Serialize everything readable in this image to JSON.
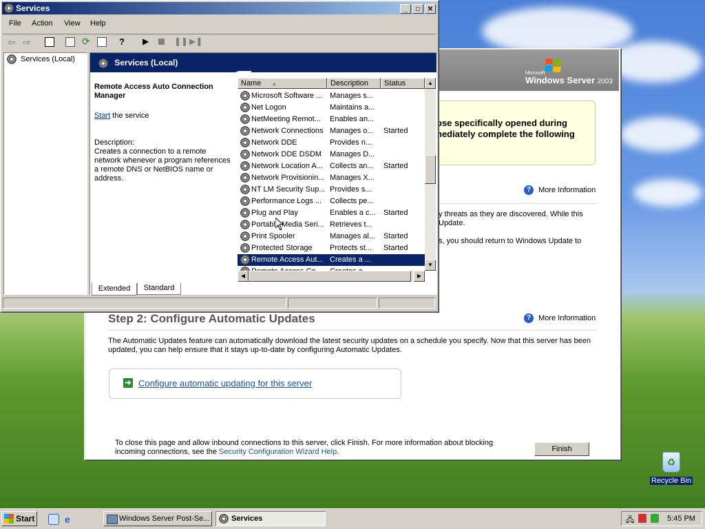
{
  "services_window": {
    "title": "Services",
    "menu": [
      "File",
      "Action",
      "View",
      "Help"
    ],
    "tree_root": "Services (Local)",
    "pane_header": "Services (Local)",
    "selected_service_name": "Remote Access Auto Connection Manager",
    "start_link": "Start",
    "start_suffix": " the service",
    "description_label": "Description:",
    "description_text": "Creates a connection to a remote network whenever a program references a remote DNS or NetBIOS name or address.",
    "columns": {
      "name": "Name",
      "description": "Description",
      "status": "Status"
    },
    "rows": [
      {
        "name": "Microsoft Software ...",
        "description": "Manages s...",
        "status": ""
      },
      {
        "name": "Net Logon",
        "description": "Maintains a...",
        "status": ""
      },
      {
        "name": "NetMeeting Remot...",
        "description": "Enables an...",
        "status": ""
      },
      {
        "name": "Network Connections",
        "description": "Manages o...",
        "status": "Started"
      },
      {
        "name": "Network DDE",
        "description": "Provides n...",
        "status": ""
      },
      {
        "name": "Network DDE DSDM",
        "description": "Manages D...",
        "status": ""
      },
      {
        "name": "Network Location A...",
        "description": "Collects an...",
        "status": "Started"
      },
      {
        "name": "Network Provisionin...",
        "description": "Manages X...",
        "status": ""
      },
      {
        "name": "NT LM Security Sup...",
        "description": "Provides s...",
        "status": ""
      },
      {
        "name": "Performance Logs ...",
        "description": "Collects pe...",
        "status": ""
      },
      {
        "name": "Plug and Play",
        "description": "Enables a c...",
        "status": "Started"
      },
      {
        "name": "Portable Media Seri...",
        "description": "Retrieves t...",
        "status": ""
      },
      {
        "name": "Print Spooler",
        "description": "Manages al...",
        "status": "Started"
      },
      {
        "name": "Protected Storage",
        "description": "Protects st...",
        "status": "Started"
      },
      {
        "name": "Remote Access Aut...",
        "description": "Creates a ...",
        "status": ""
      },
      {
        "name": "Remote Access Co...",
        "description": "Creates a ...",
        "status": ""
      }
    ],
    "tabs": [
      "Extended",
      "Standard"
    ]
  },
  "postsetup_window": {
    "brand_small": "Microsoft",
    "brand": "Windows Server",
    "brand_year": "2003",
    "notice_line1": "ose specifically opened during",
    "notice_line2": "nediately complete the following",
    "more_info_1": "More Information",
    "partial_line1": "y threats as they are discovered. While this",
    "partial_line2": "Update.",
    "partial_line3": "s, you should return to Windows Update to",
    "step2_title": "Step 2: Configure Automatic Updates",
    "more_info_2": "More Information",
    "step2_text": "The Automatic Updates feature can automatically download the latest security updates on a schedule you specify. Now that this server has been updated, you can help ensure that it stays up-to-date by configuring Automatic Updates.",
    "configure_link": "Configure automatic updating for this server",
    "footer_text": "To close this page and allow inbound connections to this server, click Finish. For more information about blocking incoming connections, see the",
    "footer_link": "Security Configuration Wizard Help",
    "footer_end": ".",
    "finish_button": "Finish"
  },
  "desktop": {
    "recycle_bin": "Recycle Bin"
  },
  "taskbar": {
    "start": "Start",
    "tasks": [
      "Windows Server Post-Se...",
      "Services"
    ],
    "clock": "5:45 PM"
  }
}
